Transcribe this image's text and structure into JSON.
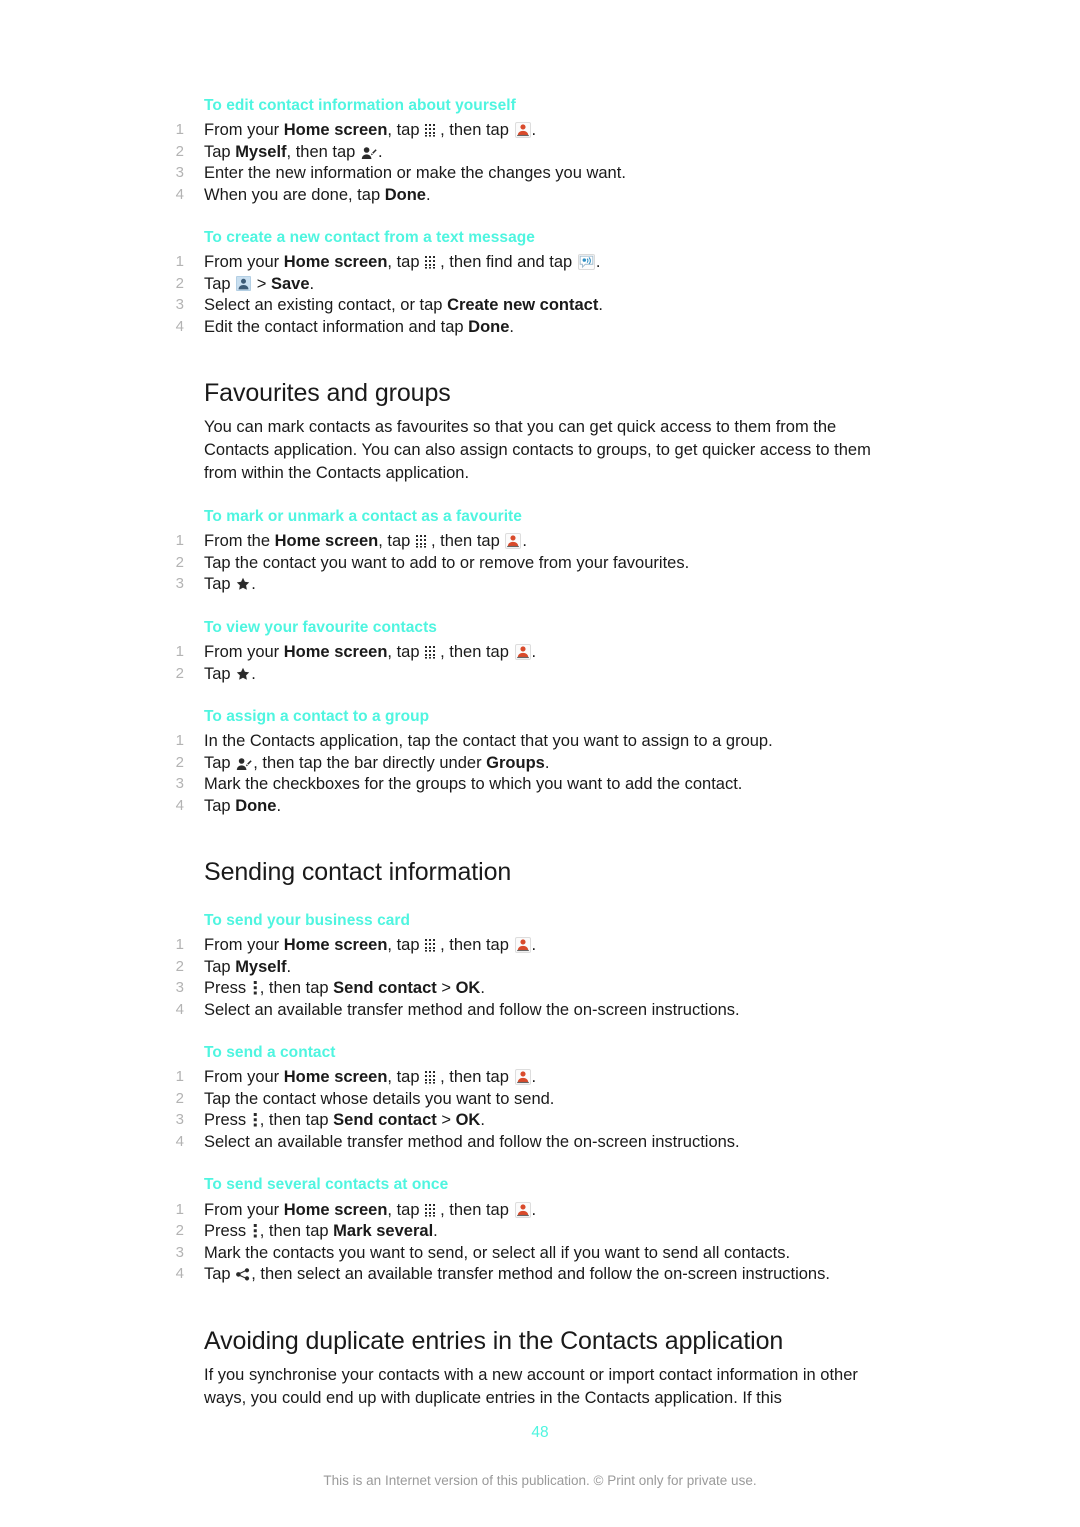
{
  "document": {
    "page_number": "48",
    "footer_note": "This is an Internet version of this publication. © Print only for private use.",
    "accent_color": "#4FF5E0",
    "text_color": "#1a1a1a",
    "step_number_color": "#b3b3b3"
  },
  "procedures": {
    "edit_self": {
      "heading": "To edit contact information about yourself",
      "steps": {
        "s1_a": "From your ",
        "s1_b": "Home screen",
        "s1_c": ", tap ",
        "s1_d": ", then tap ",
        "s1_e": ".",
        "s2_a": "Tap ",
        "s2_b": "Myself",
        "s2_c": ", then tap ",
        "s2_d": ".",
        "s3": "Enter the new information or make the changes you want.",
        "s4_a": "When you are done, tap ",
        "s4_b": "Done",
        "s4_c": "."
      }
    },
    "new_from_sms": {
      "heading": "To create a new contact from a text message",
      "steps": {
        "s1_a": "From your ",
        "s1_b": "Home screen",
        "s1_c": ", tap ",
        "s1_d": ", then find and tap ",
        "s1_e": ".",
        "s2_a": "Tap ",
        "s2_b": " > ",
        "s2_c": "Save",
        "s2_d": ".",
        "s3_a": "Select an existing contact, or tap ",
        "s3_b": "Create new contact",
        "s3_c": ".",
        "s4_a": "Edit the contact information and tap ",
        "s4_b": "Done",
        "s4_c": "."
      }
    },
    "mark_favourite": {
      "heading": "To mark or unmark a contact as a favourite",
      "steps": {
        "s1_a": "From the ",
        "s1_b": "Home screen",
        "s1_c": ", tap ",
        "s1_d": ", then tap ",
        "s1_e": ".",
        "s2": "Tap the contact you want to add to or remove from your favourites.",
        "s3_a": "Tap ",
        "s3_b": "."
      }
    },
    "view_favourites": {
      "heading": "To view your favourite contacts",
      "steps": {
        "s1_a": "From your ",
        "s1_b": "Home screen",
        "s1_c": ", tap ",
        "s1_d": ", then tap ",
        "s1_e": ".",
        "s2_a": "Tap ",
        "s2_b": "."
      }
    },
    "assign_group": {
      "heading": "To assign a contact to a group",
      "steps": {
        "s1": "In the Contacts application, tap the contact that you want to assign to a group.",
        "s2_a": "Tap ",
        "s2_b": ", then tap the bar directly under ",
        "s2_c": "Groups",
        "s2_d": ".",
        "s3": "Mark the checkboxes for the groups to which you want to add the contact.",
        "s4_a": "Tap ",
        "s4_b": "Done",
        "s4_c": "."
      }
    },
    "send_business_card": {
      "heading": "To send your business card",
      "steps": {
        "s1_a": "From your ",
        "s1_b": "Home screen",
        "s1_c": ", tap ",
        "s1_d": ", then tap ",
        "s1_e": ".",
        "s2_a": "Tap ",
        "s2_b": "Myself",
        "s2_c": ".",
        "s3_a": "Press ",
        "s3_b": ", then tap ",
        "s3_c": "Send contact",
        "s3_d": " > ",
        "s3_e": "OK",
        "s3_f": ".",
        "s4": "Select an available transfer method and follow the on-screen instructions."
      }
    },
    "send_contact": {
      "heading": "To send a contact",
      "steps": {
        "s1_a": "From your ",
        "s1_b": "Home screen",
        "s1_c": ", tap ",
        "s1_d": ", then tap ",
        "s1_e": ".",
        "s2": "Tap the contact whose details you want to send.",
        "s3_a": "Press ",
        "s3_b": ", then tap ",
        "s3_c": "Send contact",
        "s3_d": " > ",
        "s3_e": "OK",
        "s3_f": ".",
        "s4": "Select an available transfer method and follow the on-screen instructions."
      }
    },
    "send_several": {
      "heading": "To send several contacts at once",
      "steps": {
        "s1_a": "From your ",
        "s1_b": "Home screen",
        "s1_c": ", tap ",
        "s1_d": ", then tap ",
        "s1_e": ".",
        "s2_a": "Press ",
        "s2_b": ", then tap ",
        "s2_c": "Mark several",
        "s2_d": ".",
        "s3": "Mark the contacts you want to send, or select all if you want to send all contacts.",
        "s4_a": "Tap ",
        "s4_b": ", then select an available transfer method and follow the on-screen instructions."
      }
    }
  },
  "sections": {
    "favourites_groups": {
      "title": "Favourites and groups",
      "intro": "You can mark contacts as favourites so that you can get quick access to them from the Contacts application. You can also assign contacts to groups, to get quicker access to them from within the Contacts application."
    },
    "sending_contact_information": {
      "title": "Sending contact information"
    },
    "avoiding_duplicates": {
      "title": "Avoiding duplicate entries in the Contacts application",
      "intro": "If you synchronise your contacts with a new account or import contact information in other ways, you could end up with duplicate entries in the Contacts application. If this"
    }
  },
  "icons": {
    "app_grid": "app-grid-icon",
    "contacts": "contacts-icon",
    "edit_contact": "edit-contact-icon",
    "messaging": "messaging-icon",
    "avatar": "avatar-icon",
    "star": "star-icon",
    "overflow_menu": "overflow-menu-icon",
    "share": "share-icon"
  }
}
